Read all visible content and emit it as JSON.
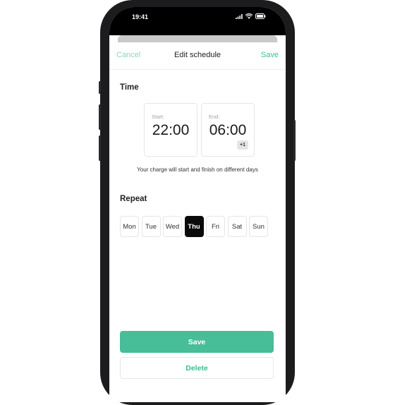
{
  "status_bar": {
    "time": "19:41"
  },
  "nav": {
    "cancel_label": "Cancel",
    "title": "Edit schedule",
    "save_label": "Save"
  },
  "time_section": {
    "title": "Time",
    "start": {
      "label": "Start:",
      "value": "22:00"
    },
    "end": {
      "label": "End:",
      "value": "06:00",
      "badge": "+1"
    },
    "note": "Your charge will start and finish on different days"
  },
  "repeat_section": {
    "title": "Repeat",
    "days": [
      {
        "label": "Mon",
        "selected": false
      },
      {
        "label": "Tue",
        "selected": false
      },
      {
        "label": "Wed",
        "selected": false
      },
      {
        "label": "Thu",
        "selected": true
      },
      {
        "label": "Fri",
        "selected": false
      },
      {
        "label": "Sat",
        "selected": false
      },
      {
        "label": "Sun",
        "selected": false
      }
    ]
  },
  "actions": {
    "save_label": "Save",
    "delete_label": "Delete"
  },
  "colors": {
    "accent": "#47bd98",
    "accent_text": "#3bbd96",
    "selected_day": "#0a0a0a"
  }
}
